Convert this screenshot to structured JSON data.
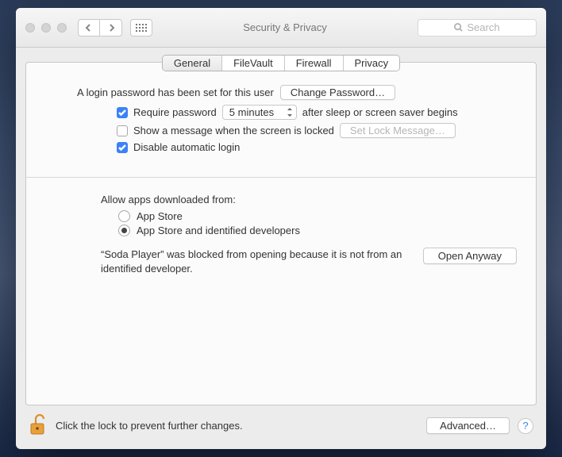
{
  "window": {
    "title": "Security & Privacy"
  },
  "toolbar": {
    "search_placeholder": "Search"
  },
  "tabs": [
    "General",
    "FileVault",
    "Firewall",
    "Privacy"
  ],
  "active_tab": 0,
  "general": {
    "login_password_text": "A login password has been set for this user",
    "change_password_btn": "Change Password…",
    "require_password": {
      "checked": true,
      "label_before": "Require password",
      "delay_value": "5 minutes",
      "label_after": "after sleep or screen saver begins"
    },
    "show_message": {
      "checked": false,
      "label": "Show a message when the screen is locked",
      "set_btn": "Set Lock Message…"
    },
    "disable_auto_login": {
      "checked": true,
      "label": "Disable automatic login"
    },
    "allow_apps": {
      "heading": "Allow apps downloaded from:",
      "options": [
        {
          "label": "App Store",
          "selected": false
        },
        {
          "label": "App Store and identified developers",
          "selected": true
        }
      ]
    },
    "blocked_app": {
      "message": "“Soda Player” was blocked from opening because it is not from an identified developer.",
      "open_btn": "Open Anyway"
    }
  },
  "footer": {
    "lock_text": "Click the lock to prevent further changes.",
    "advanced_btn": "Advanced…",
    "help_label": "?"
  }
}
